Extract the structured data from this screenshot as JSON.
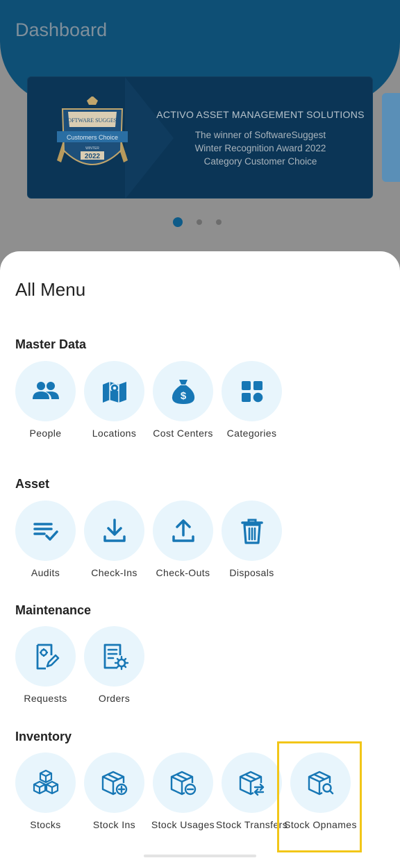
{
  "dashboard": {
    "title": "Dashboard",
    "banner": {
      "badge_brand": "SOFTWARE SUGGEST",
      "badge_ribbon": "Customers Choice",
      "badge_season": "WINTER",
      "badge_year": "2022",
      "title": "ACTIVO ASSET MANAGEMENT SOLUTIONS",
      "lines": [
        "The winner of SoftwareSuggest",
        "Winter Recognition Award 2022",
        "Category Customer Choice"
      ]
    },
    "carousel": {
      "count": 3,
      "active_index": 0
    }
  },
  "menu": {
    "title": "All Menu",
    "sections": [
      {
        "title": "Master Data",
        "items": [
          {
            "label": "People",
            "icon": "people-icon"
          },
          {
            "label": "Locations",
            "icon": "map-icon"
          },
          {
            "label": "Cost Centers",
            "icon": "money-bag-icon"
          },
          {
            "label": "Categories",
            "icon": "categories-icon"
          }
        ]
      },
      {
        "title": "Asset",
        "items": [
          {
            "label": "Audits",
            "icon": "checklist-icon"
          },
          {
            "label": "Check-Ins",
            "icon": "download-icon"
          },
          {
            "label": "Check-Outs",
            "icon": "upload-icon"
          },
          {
            "label": "Disposals",
            "icon": "trash-icon"
          }
        ]
      },
      {
        "title": "Maintenance",
        "items": [
          {
            "label": "Requests",
            "icon": "request-edit-icon"
          },
          {
            "label": "Orders",
            "icon": "order-settings-icon"
          }
        ]
      },
      {
        "title": "Inventory",
        "items": [
          {
            "label": "Stocks",
            "icon": "stacked-boxes-icon"
          },
          {
            "label": "Stock Ins",
            "icon": "box-plus-icon"
          },
          {
            "label": "Stock Usages",
            "icon": "box-minus-icon"
          },
          {
            "label": "Stock Transfers",
            "icon": "box-transfer-icon"
          },
          {
            "label": "Stock Opnames",
            "icon": "box-search-icon",
            "highlighted": true
          }
        ]
      }
    ]
  },
  "colors": {
    "accent": "#1777b5",
    "icon_circle": "#e8f5fc",
    "highlight": "#f2c618",
    "header": "#0e4f75"
  }
}
